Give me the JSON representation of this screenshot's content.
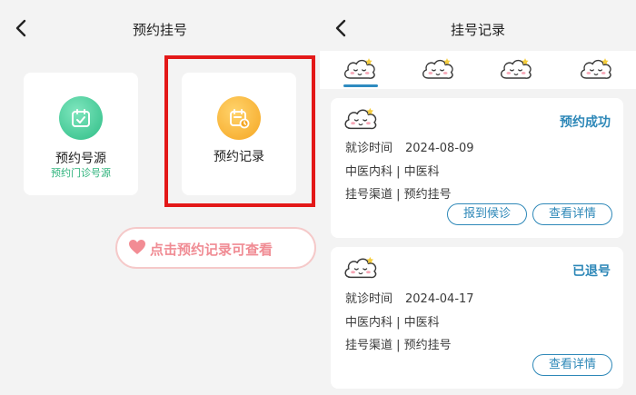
{
  "left": {
    "title": "预约挂号",
    "tiles": [
      {
        "label": "预约号源",
        "sub": "预约门诊号源"
      },
      {
        "label": "预约记录"
      }
    ],
    "hint": "点击预约记录可查看"
  },
  "right": {
    "title": "挂号记录",
    "records": [
      {
        "status": "预约成功",
        "time_label": "就诊时间",
        "time_value": "2024-08-09",
        "dept": "中医内科 | 中医科",
        "channel": "挂号渠道 | 预约挂号",
        "buttons": [
          "报到候诊",
          "查看详情"
        ]
      },
      {
        "status": "已退号",
        "time_label": "就诊时间",
        "time_value": "2024-04-17",
        "dept": "中医内科 | 中医科",
        "channel": "挂号渠道 | 预约挂号",
        "buttons": [
          "查看详情"
        ]
      }
    ]
  },
  "icons": {
    "back": "chevron-left-icon",
    "tile_a": "calendar-check-icon",
    "tile_b": "calendar-clock-icon",
    "hint": "heart-icon",
    "tabs": "cloud-face-icon"
  },
  "colors": {
    "accent": "#2e88b8",
    "highlight": "#e31818",
    "green": "#2eb37c",
    "orange": "#f5a623",
    "hint_text": "#f08c94"
  }
}
